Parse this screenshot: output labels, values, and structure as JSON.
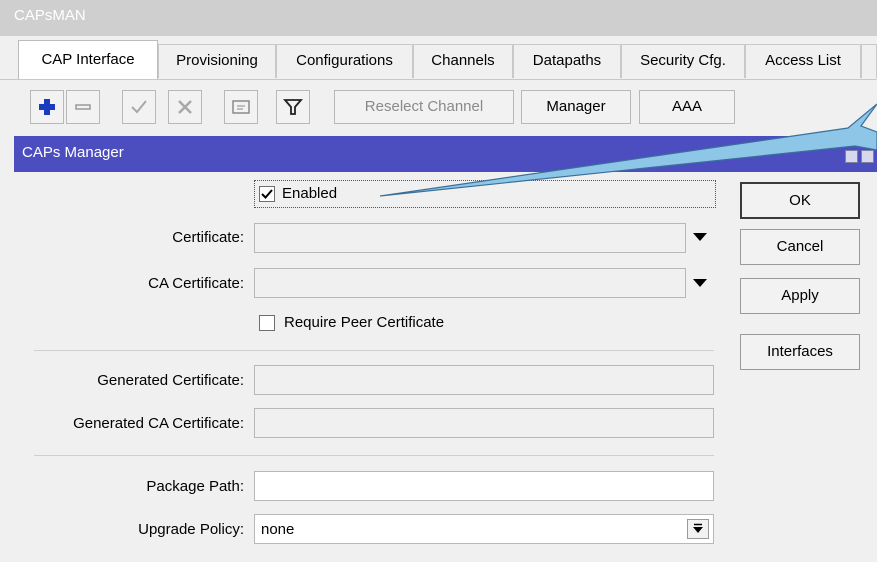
{
  "window": {
    "title": "CAPsMAN"
  },
  "tabs": [
    {
      "label": "CAP Interface"
    },
    {
      "label": "Provisioning"
    },
    {
      "label": "Configurations"
    },
    {
      "label": "Channels"
    },
    {
      "label": "Datapaths"
    },
    {
      "label": "Security Cfg."
    },
    {
      "label": "Access List"
    }
  ],
  "toolbar": {
    "add_icon": "plus-icon",
    "remove_icon": "minus-icon",
    "enable_icon": "check-icon",
    "disable_icon": "cross-icon",
    "comment_icon": "comment-icon",
    "filter_icon": "filter-icon",
    "reselect_label": "Reselect Channel",
    "manager_label": "Manager",
    "aaa_label": "AAA"
  },
  "dialog": {
    "title": "CAPs Manager",
    "enabled": {
      "label": "Enabled",
      "checked": true
    },
    "certificate": {
      "label": "Certificate:",
      "value": ""
    },
    "ca_certificate": {
      "label": "CA Certificate:",
      "value": ""
    },
    "require_peer": {
      "label": "Require Peer Certificate",
      "checked": false
    },
    "generated_certificate": {
      "label": "Generated Certificate:",
      "value": ""
    },
    "generated_ca_certificate": {
      "label": "Generated CA Certificate:",
      "value": ""
    },
    "package_path": {
      "label": "Package Path:",
      "value": ""
    },
    "upgrade_policy": {
      "label": "Upgrade Policy:",
      "value": "none"
    },
    "buttons": {
      "ok": "OK",
      "cancel": "Cancel",
      "apply": "Apply",
      "interfaces": "Interfaces"
    }
  },
  "colors": {
    "dialog_title_bg": "#4c4ec0",
    "callout": "#8ec6e8",
    "add_icon": "#1a3bbf"
  }
}
